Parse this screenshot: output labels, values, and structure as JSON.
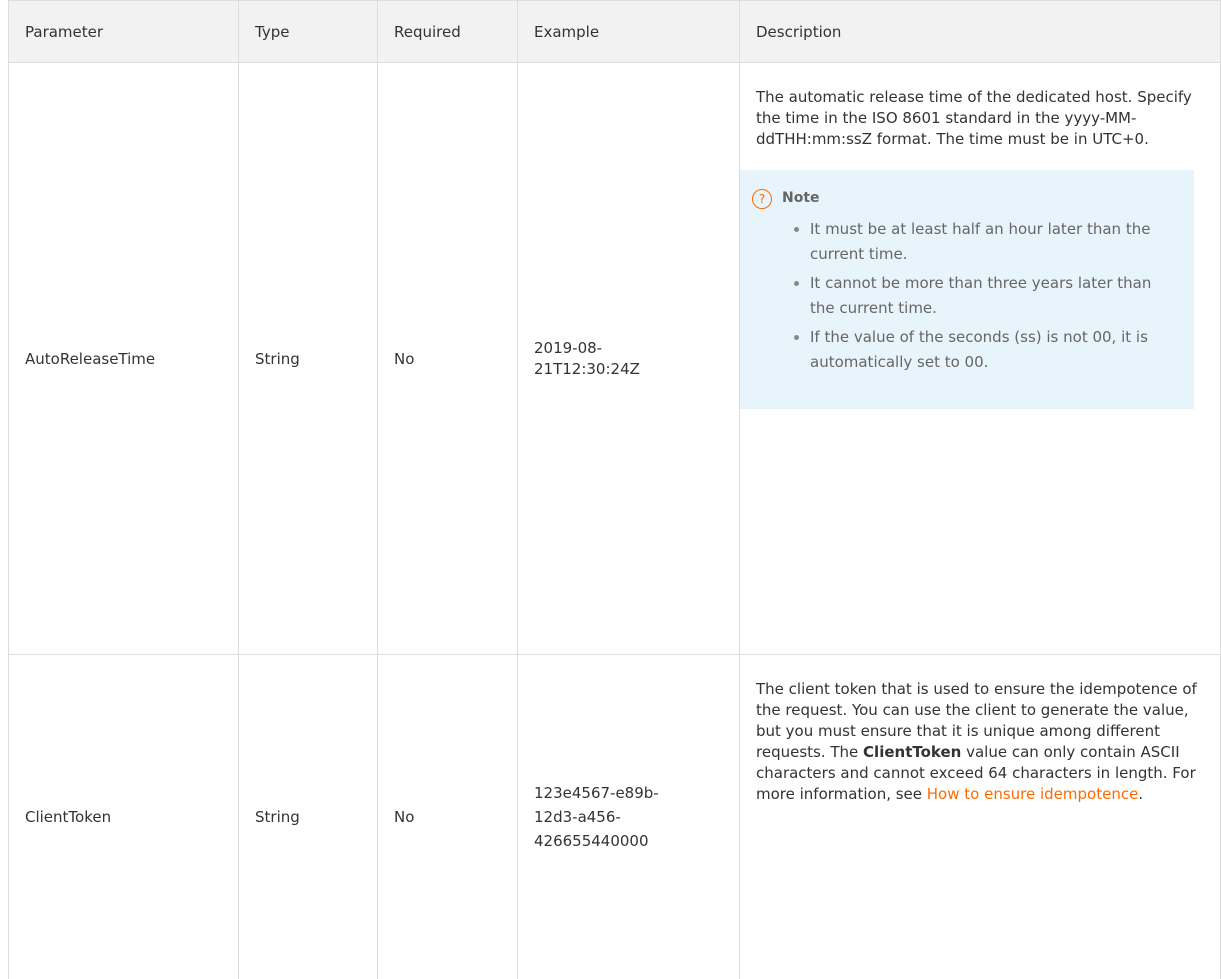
{
  "headers": {
    "parameter": "Parameter",
    "type": "Type",
    "required": "Required",
    "example": "Example",
    "description": "Description"
  },
  "rows": [
    {
      "parameter": "AutoReleaseTime",
      "type": "String",
      "required": "No",
      "example_line1": "2019-08-",
      "example_line2": "21T12:30:24Z",
      "description": "The automatic release time of the dedicated host. Specify the time in the ISO 8601 standard in the yyyy-MM-ddTHH:mm:ssZ format. The time must be in UTC+0.",
      "note": {
        "icon": "question-icon",
        "title": "Note",
        "items": [
          "It must be at least half an hour later than the current time.",
          "It cannot be more than three years later than the current time.",
          "If the value of the seconds (ss) is not 00, it is automatically set to 00."
        ]
      }
    },
    {
      "parameter": "ClientToken",
      "type": "String",
      "required": "No",
      "example_line1": "123e4567-e89b-",
      "example_line2": "12d3-a456-",
      "example_line3": "426655440000",
      "description_part1": "The client token that is used to ensure the idempotence of the request. You can use the client to generate the value, but you must ensure that it is unique among different requests. The ",
      "description_bold": "ClientToken",
      "description_part2": " value can only contain ASCII characters and cannot exceed 64 characters in length. For more information, see ",
      "description_link": "How to ensure idempotence",
      "description_end": "."
    }
  ],
  "colors": {
    "link": "#ff6a00",
    "note_bg": "#e8f4fb",
    "header_bg": "#f2f2f2"
  }
}
